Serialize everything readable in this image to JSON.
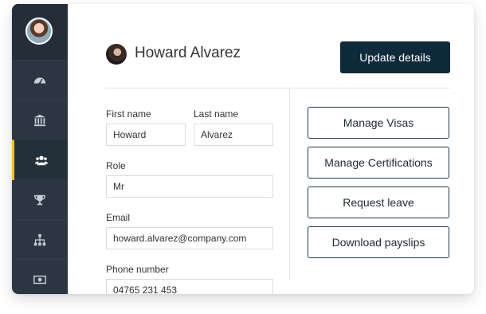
{
  "sidebar": {
    "items": [
      {
        "icon": "dashboard-icon"
      },
      {
        "icon": "bank-icon"
      },
      {
        "icon": "people-icon",
        "active": true
      },
      {
        "icon": "trophy-icon"
      },
      {
        "icon": "org-chart-icon"
      },
      {
        "icon": "money-icon"
      }
    ],
    "accent": "#f2c400"
  },
  "header": {
    "name": "Howard Alvarez",
    "update_button": "Update details"
  },
  "form": {
    "first_name_label": "First name",
    "first_name_value": "Howard",
    "last_name_label": "Last name",
    "last_name_value": "Alvarez",
    "role_label": "Role",
    "role_value": "Mr",
    "email_label": "Email",
    "email_value": "howard.alvarez@company.com",
    "phone_label": "Phone number",
    "phone_value": "04765 231 453"
  },
  "actions": {
    "manage_visas": "Manage Visas",
    "manage_certifications": "Manage Certifications",
    "request_leave": "Request leave",
    "download_payslips": "Download payslips"
  },
  "colors": {
    "sidebar": "#2b3642",
    "primary_button": "#0f2a3a"
  }
}
